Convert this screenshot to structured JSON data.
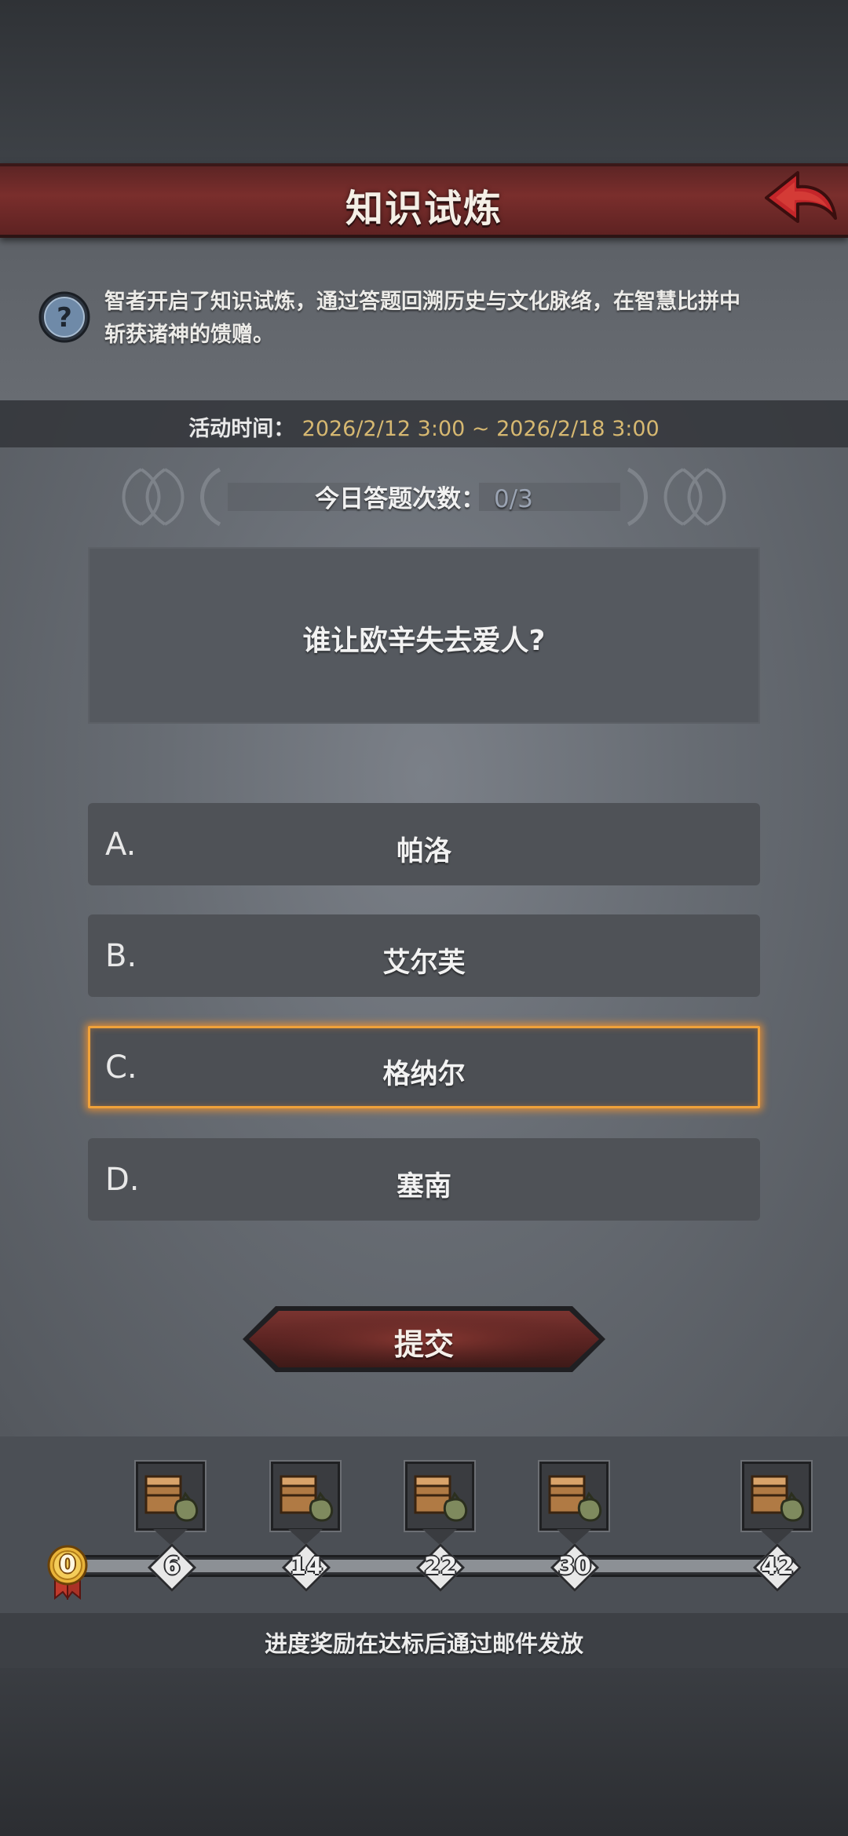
{
  "header": {
    "title": "知识试炼",
    "back_icon": "red-back-arrow-icon"
  },
  "intro": {
    "help_icon": "question-mark-icon",
    "description": "智者开启了知识试炼，通过答题回溯历史与文化脉络，在智慧比拼中斩获诸神的馈赠。"
  },
  "event": {
    "time_label": "活动时间：",
    "time_value": "2026/2/12 3:00 ~ 2026/2/18 3:00"
  },
  "daily": {
    "label": "今日答题次数：",
    "value": "0/3"
  },
  "question": {
    "text": "谁让欧辛失去爱人?"
  },
  "options": [
    {
      "letter": "A.",
      "text": "帕洛",
      "selected": false
    },
    {
      "letter": "B.",
      "text": "艾尔芙",
      "selected": false
    },
    {
      "letter": "C.",
      "text": "格纳尔",
      "selected": true
    },
    {
      "letter": "D.",
      "text": "塞南",
      "selected": false
    }
  ],
  "submit": {
    "label": "提交"
  },
  "progress": {
    "current": "0",
    "milestones": [
      "6",
      "14",
      "22",
      "30",
      "42"
    ],
    "reward_icon": "supply-crate-and-sack-icon"
  },
  "footer": {
    "note": "进度奖励在达标后通过邮件发放"
  },
  "colors": {
    "accent_gold": "#d6b871",
    "title_red": "#7a2e2c",
    "selected_glow": "#f0a23a"
  }
}
